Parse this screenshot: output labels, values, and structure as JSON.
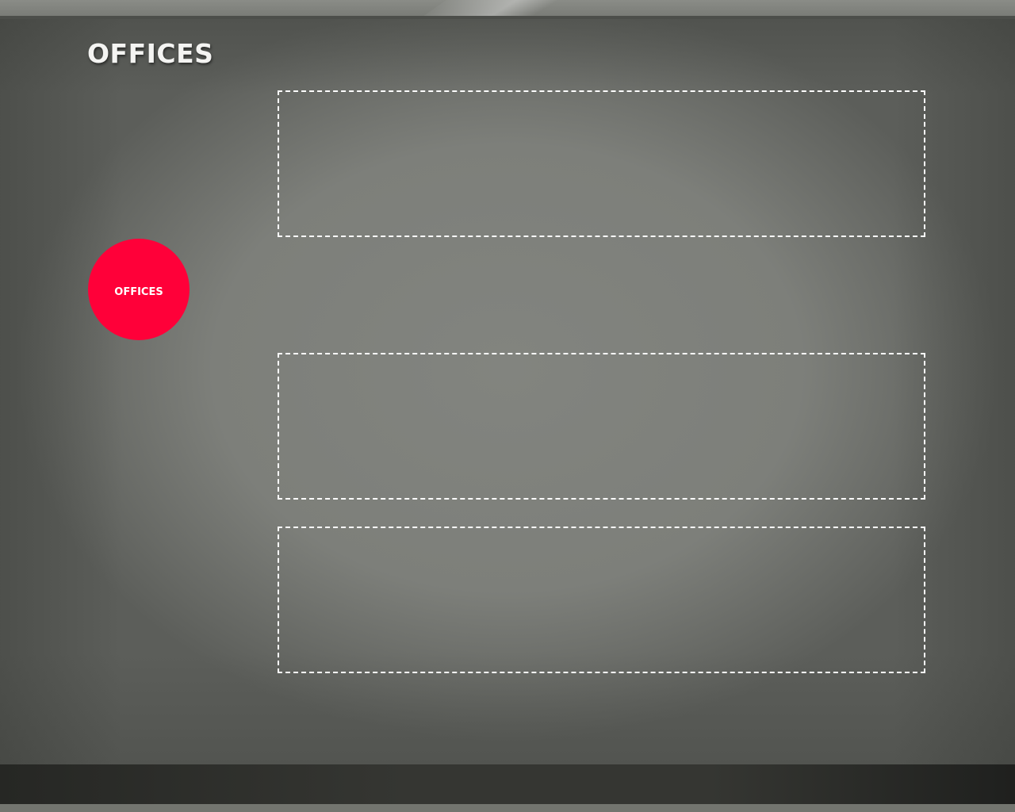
{
  "slide": {
    "title": "OFFICES",
    "badge_label": "OFFICES"
  },
  "colors": {
    "background": "#7c7e79",
    "badge": "#ff0039",
    "placeholder_border": "#ffffff",
    "footer": "#353632"
  }
}
